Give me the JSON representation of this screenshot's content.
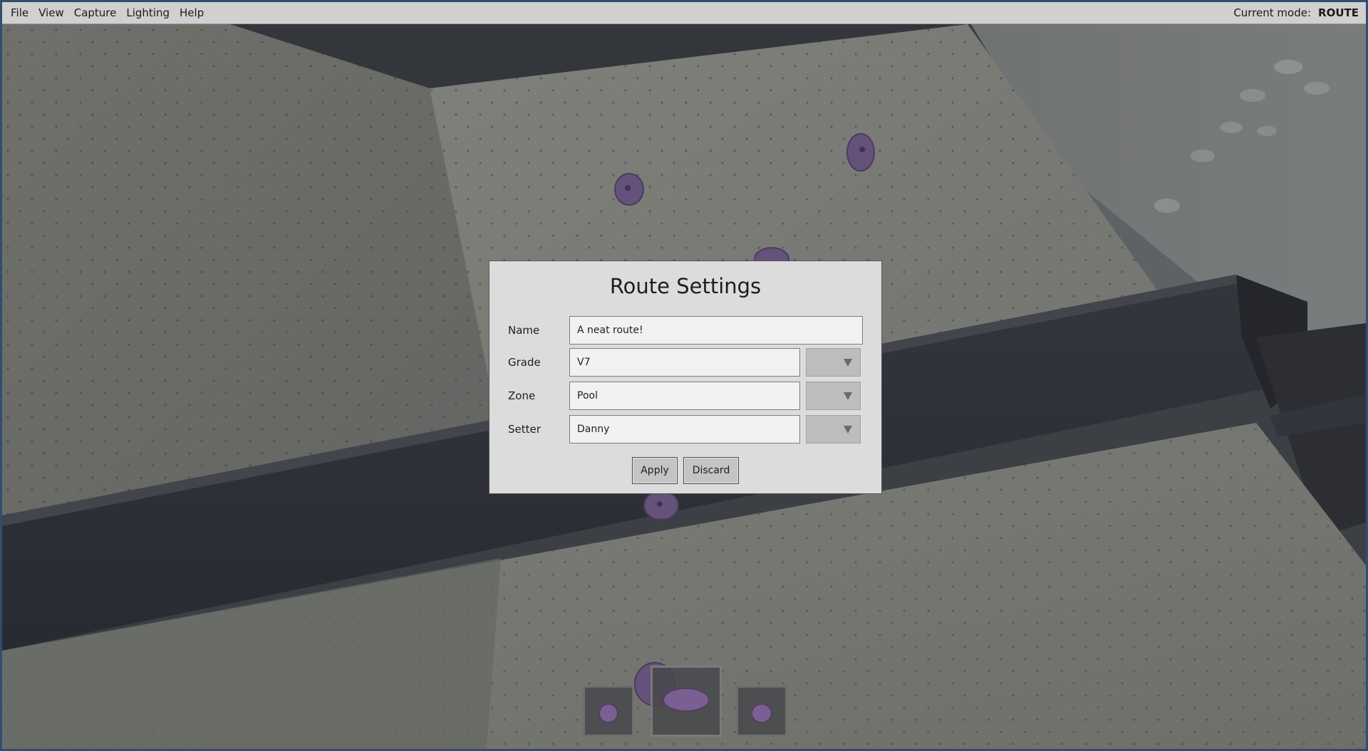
{
  "menubar": {
    "items": [
      "File",
      "View",
      "Capture",
      "Lighting",
      "Help"
    ],
    "mode_label": "Current mode:",
    "mode_value": "ROUTE"
  },
  "dialog": {
    "title": "Route Settings",
    "fields": {
      "name": {
        "label": "Name",
        "value": "A neat route!"
      },
      "grade": {
        "label": "Grade",
        "value": "V7"
      },
      "zone": {
        "label": "Zone",
        "value": "Pool"
      },
      "setter": {
        "label": "Setter",
        "value": "Danny"
      }
    },
    "apply_label": "Apply",
    "discard_label": "Discard"
  },
  "hold_tray": {
    "slots": [
      "hold-slot-1",
      "hold-slot-2-selected",
      "hold-slot-3"
    ]
  },
  "colors": {
    "window_border": "#2e4f6e",
    "menubar_bg": "#d0d0d0",
    "dialog_bg": "#dcdcdc",
    "hold_purple": "#8a6aa6"
  }
}
